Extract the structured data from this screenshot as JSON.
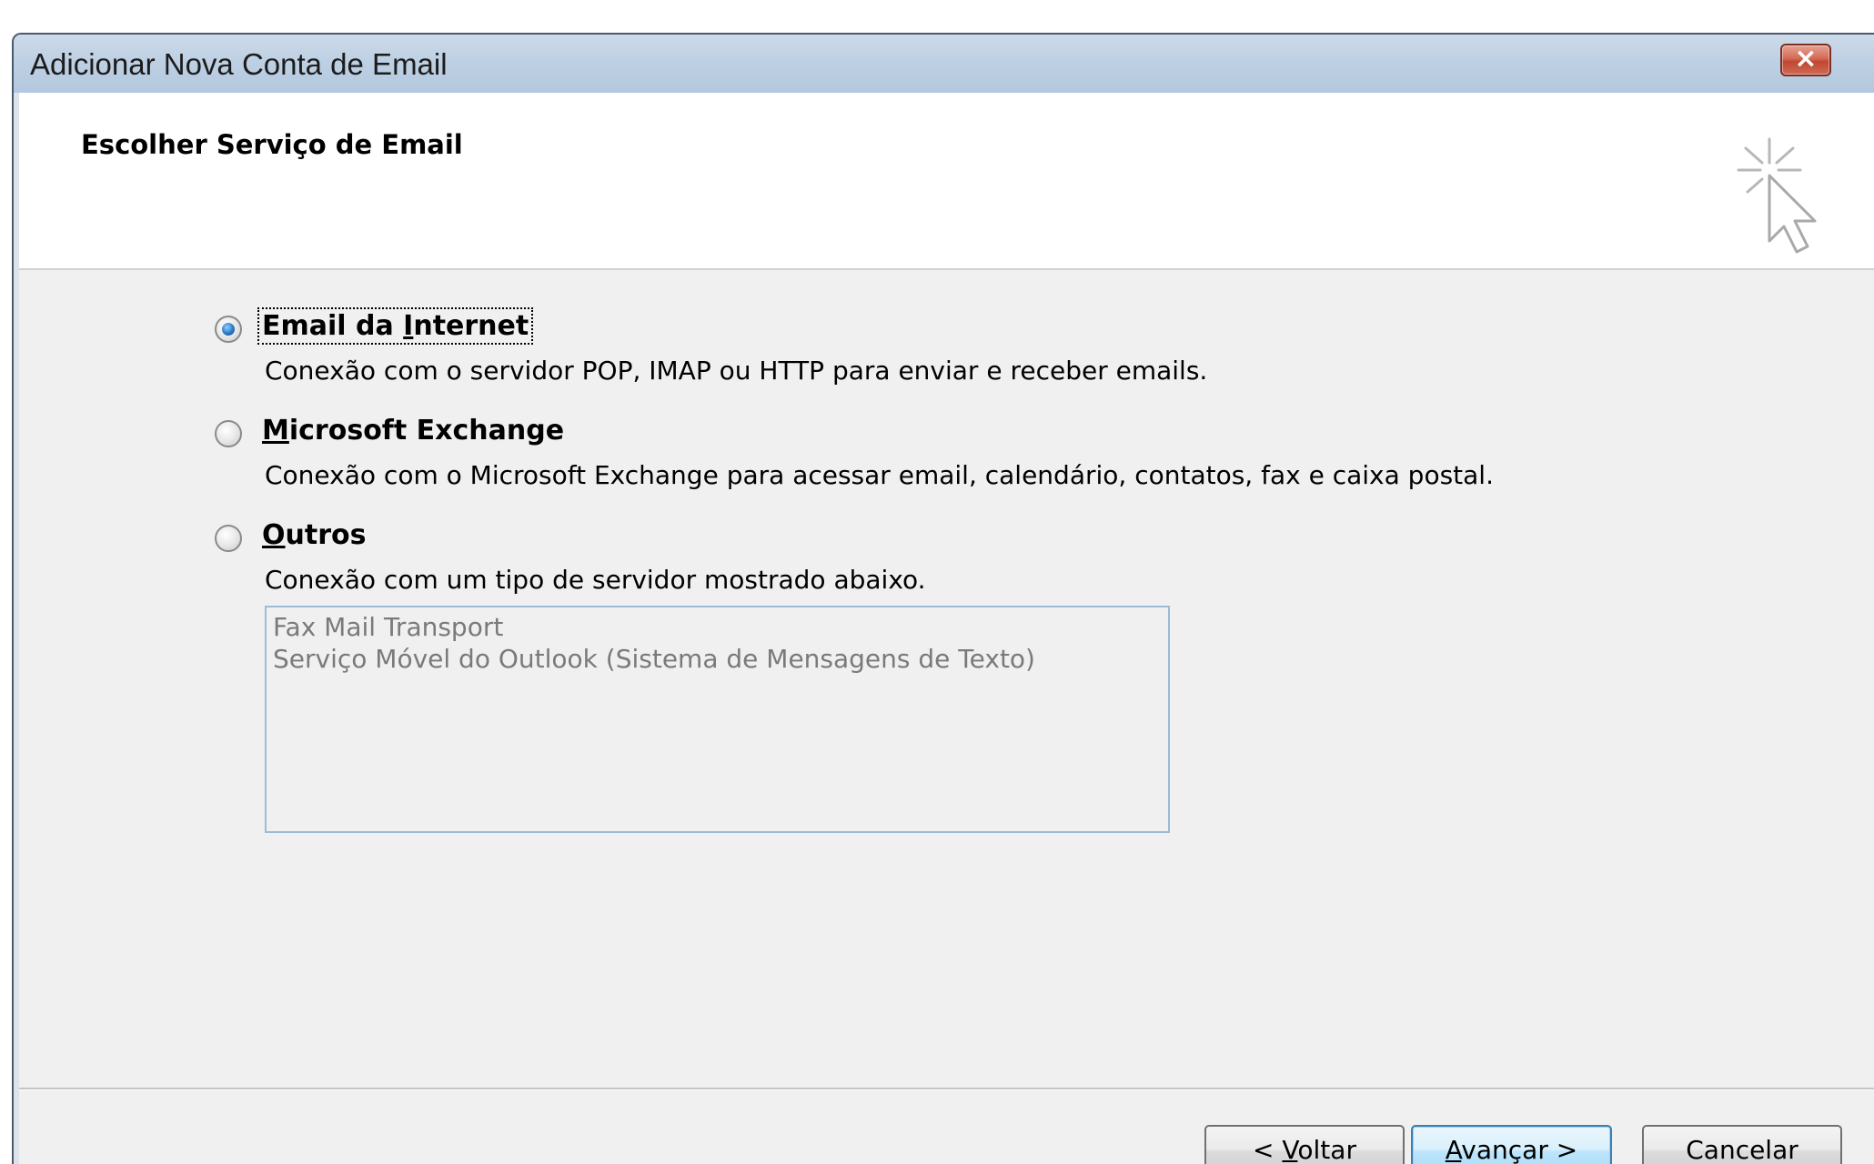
{
  "window": {
    "title": "Adicionar Nova Conta de Email",
    "close_glyph": "×"
  },
  "header": {
    "title": "Escolher Serviço de Email",
    "icon": "wizard-cursor-icon"
  },
  "options": [
    {
      "mnemonic_pre": "Email da ",
      "mnemonic": "I",
      "mnemonic_post": "nternet",
      "description": "Conexão com o servidor POP, IMAP ou HTTP para enviar e receber emails.",
      "checked": true
    },
    {
      "mnemonic_pre": "",
      "mnemonic": "M",
      "mnemonic_post": "icrosoft Exchange",
      "description": "Conexão com o Microsoft Exchange para acessar email, calendário, contatos, fax e caixa postal.",
      "checked": false
    },
    {
      "mnemonic_pre": "",
      "mnemonic": "O",
      "mnemonic_post": "utros",
      "description": "Conexão com um tipo de servidor mostrado abaixo.",
      "checked": false
    }
  ],
  "other_services": [
    "Fax Mail Transport",
    "Serviço Móvel do Outlook (Sistema de Mensagens de Texto)"
  ],
  "buttons": {
    "back": {
      "pre": "< ",
      "mnemonic": "V",
      "post": "oltar"
    },
    "next": {
      "pre": "",
      "mnemonic": "A",
      "post": "vançar >"
    },
    "cancel": "Cancelar"
  },
  "colors": {
    "titlebar": "#bed0e3",
    "close_button": "#c24631",
    "default_button": "#bee6fd",
    "dialog_background": "#f0f0f0"
  }
}
